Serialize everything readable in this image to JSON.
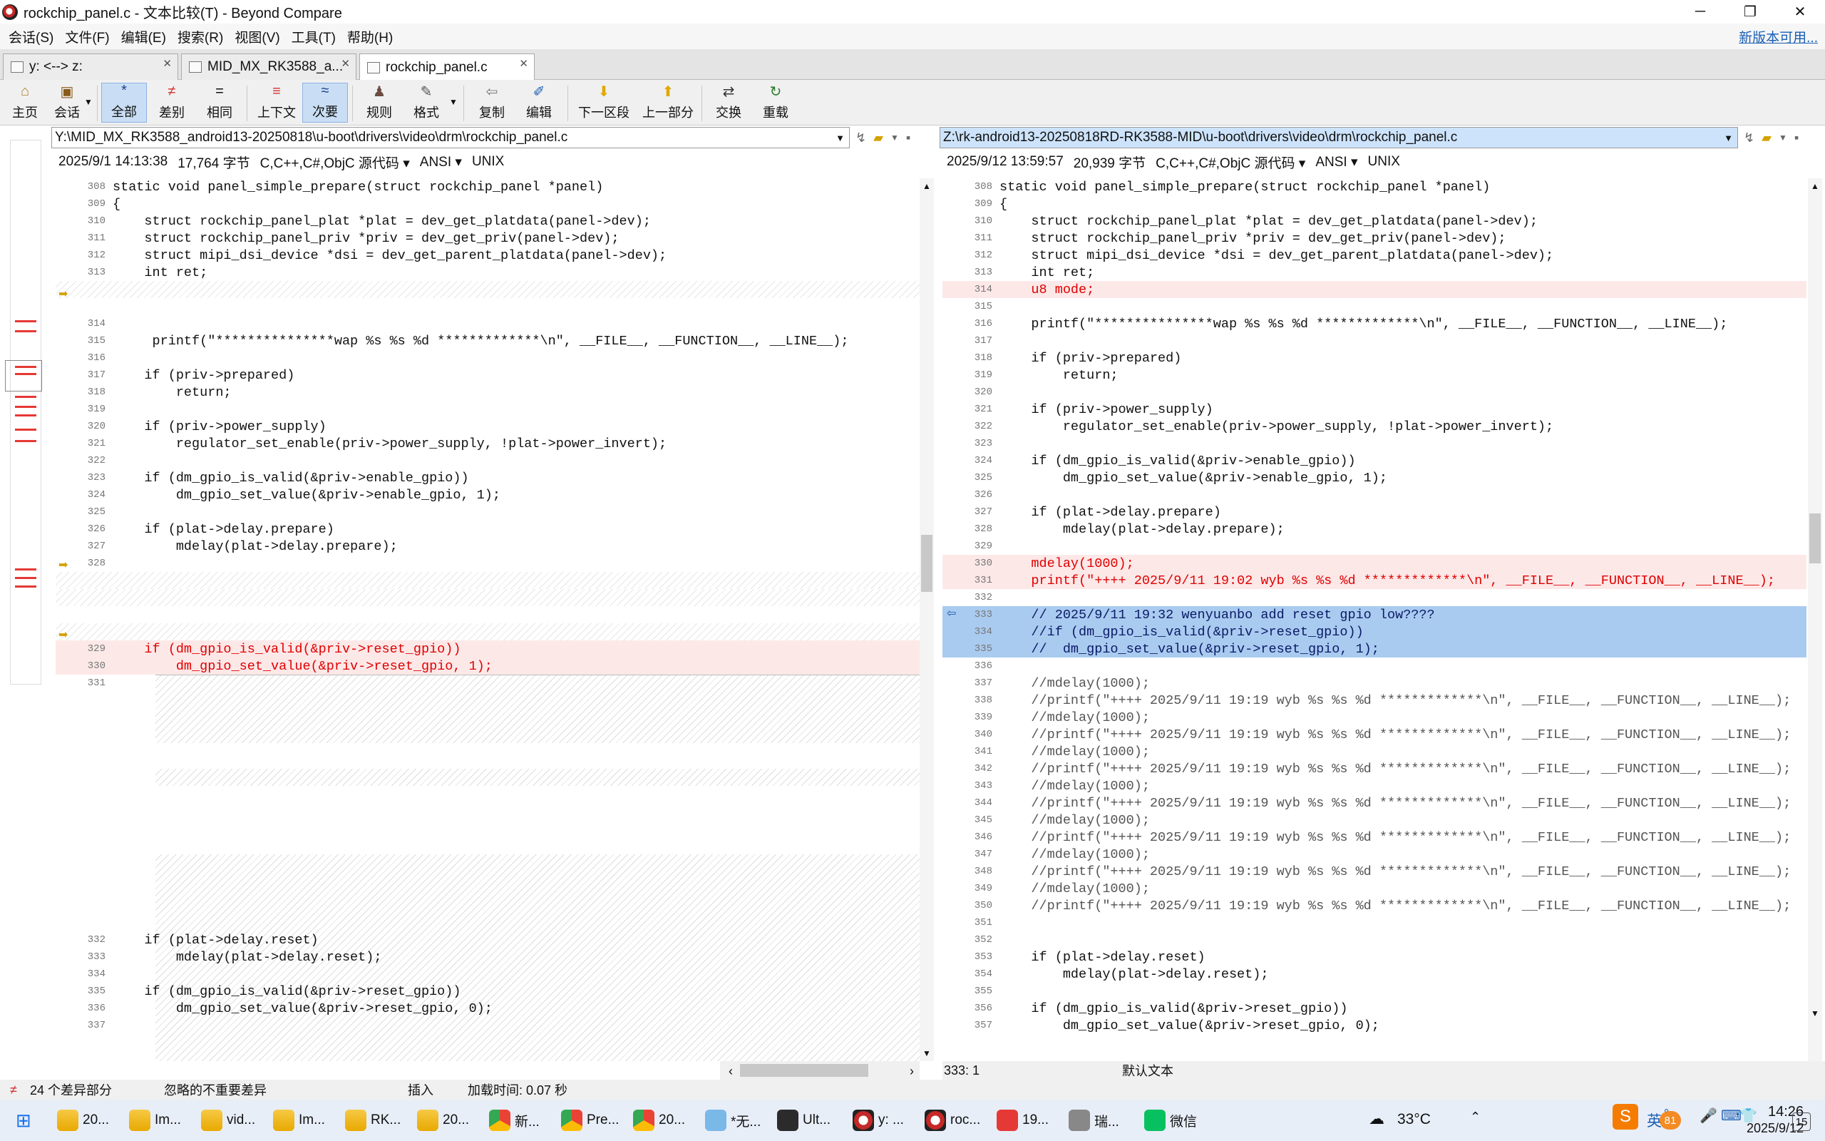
{
  "window": {
    "title": "rockchip_panel.c - 文本比较(T) - Beyond Compare",
    "min": "─",
    "max": "❐",
    "close": "✕"
  },
  "menu": {
    "items": [
      "会话(S)",
      "文件(F)",
      "编辑(E)",
      "搜索(R)",
      "视图(V)",
      "工具(T)",
      "帮助(H)"
    ],
    "update": "新版本可用..."
  },
  "tabs": [
    {
      "label": "y: <--> z:"
    },
    {
      "label": "MID_MX_RK3588_a..."
    },
    {
      "label": "rockchip_panel.c"
    }
  ],
  "toolbar": {
    "home": "主页",
    "session": "会话",
    "all": "全部",
    "diffs": "差别",
    "same": "相同",
    "context": "上下文",
    "minor": "次要",
    "rules": "规则",
    "format": "格式",
    "copy": "复制",
    "edit": "编辑",
    "next": "下一区段",
    "prev": "上一部分",
    "swap": "交换",
    "reload": "重载"
  },
  "left": {
    "path": "Y:\\MID_MX_RK3588_android13-20250818\\u-boot\\drivers\\video\\drm\\rockchip_panel.c",
    "date": "2025/9/1 14:13:38",
    "size": "17,764 字节",
    "lang": "C,C++,C#,ObjC 源代码",
    "enc": "ANSI",
    "eol": "UNIX"
  },
  "right": {
    "path": "Z:\\rk-android13-20250818RD-RK3588-MID\\u-boot\\drivers\\video\\drm\\rockchip_panel.c",
    "date": "2025/9/12 13:59:57",
    "size": "20,939 字节",
    "lang": "C,C++,C#,ObjC 源代码",
    "enc": "ANSI",
    "eol": "UNIX"
  },
  "left_lines": [
    {
      "n": "308",
      "t": "static void panel_simple_prepare(struct rockchip_panel *panel)"
    },
    {
      "n": "309",
      "t": "{"
    },
    {
      "n": "310",
      "t": "    struct rockchip_panel_plat *plat = dev_get_platdata(panel->dev);"
    },
    {
      "n": "311",
      "t": "    struct rockchip_panel_priv *priv = dev_get_priv(panel->dev);"
    },
    {
      "n": "312",
      "t": "    struct mipi_dsi_device *dsi = dev_get_parent_platdata(panel->dev);"
    },
    {
      "n": "313",
      "t": "    int ret;"
    },
    {
      "n": "",
      "t": "",
      "cls": "gap"
    },
    {
      "n": "",
      "t": ""
    },
    {
      "n": "314",
      "t": ""
    },
    {
      "n": "315",
      "t": "     printf(\"***************wap %s %s %d *************\\n\", __FILE__, __FUNCTION__, __LINE__);"
    },
    {
      "n": "316",
      "t": ""
    },
    {
      "n": "317",
      "t": "    if (priv->prepared)"
    },
    {
      "n": "318",
      "t": "        return;"
    },
    {
      "n": "319",
      "t": ""
    },
    {
      "n": "320",
      "t": "    if (priv->power_supply)"
    },
    {
      "n": "321",
      "t": "        regulator_set_enable(priv->power_supply, !plat->power_invert);"
    },
    {
      "n": "322",
      "t": ""
    },
    {
      "n": "323",
      "t": "    if (dm_gpio_is_valid(&priv->enable_gpio))"
    },
    {
      "n": "324",
      "t": "        dm_gpio_set_value(&priv->enable_gpio, 1);"
    },
    {
      "n": "325",
      "t": ""
    },
    {
      "n": "326",
      "t": "    if (plat->delay.prepare)"
    },
    {
      "n": "327",
      "t": "        mdelay(plat->delay.prepare);"
    },
    {
      "n": "328",
      "t": ""
    },
    {
      "n": "",
      "t": "",
      "cls": "gap"
    },
    {
      "n": "",
      "t": "",
      "cls": "gap"
    },
    {
      "n": "",
      "t": ""
    },
    {
      "n": "",
      "t": "",
      "cls": "gap"
    },
    {
      "n": "329",
      "t": "    if (dm_gpio_is_valid(&priv->reset_gpio))",
      "cls": "diff"
    },
    {
      "n": "330",
      "t": "        dm_gpio_set_value(&priv->reset_gpio, 1);",
      "cls": "diff"
    },
    {
      "n": "331",
      "t": ""
    }
  ],
  "left_tail": [
    {
      "n": "332",
      "t": "    if (plat->delay.reset)"
    },
    {
      "n": "333",
      "t": "        mdelay(plat->delay.reset);"
    },
    {
      "n": "334",
      "t": ""
    },
    {
      "n": "335",
      "t": "    if (dm_gpio_is_valid(&priv->reset_gpio))"
    },
    {
      "n": "336",
      "t": "        dm_gpio_set_value(&priv->reset_gpio, 0);"
    },
    {
      "n": "337",
      "t": ""
    }
  ],
  "right_lines": [
    {
      "n": "308",
      "t": "static void panel_simple_prepare(struct rockchip_panel *panel)"
    },
    {
      "n": "309",
      "t": "{"
    },
    {
      "n": "310",
      "t": "    struct rockchip_panel_plat *plat = dev_get_platdata(panel->dev);"
    },
    {
      "n": "311",
      "t": "    struct rockchip_panel_priv *priv = dev_get_priv(panel->dev);"
    },
    {
      "n": "312",
      "t": "    struct mipi_dsi_device *dsi = dev_get_parent_platdata(panel->dev);"
    },
    {
      "n": "313",
      "t": "    int ret;"
    },
    {
      "n": "314",
      "t": "    u8 mode;",
      "cls": "diff"
    },
    {
      "n": "315",
      "t": ""
    },
    {
      "n": "316",
      "t": "    printf(\"***************wap %s %s %d *************\\n\", __FILE__, __FUNCTION__, __LINE__);"
    },
    {
      "n": "317",
      "t": ""
    },
    {
      "n": "318",
      "t": "    if (priv->prepared)"
    },
    {
      "n": "319",
      "t": "        return;"
    },
    {
      "n": "320",
      "t": ""
    },
    {
      "n": "321",
      "t": "    if (priv->power_supply)"
    },
    {
      "n": "322",
      "t": "        regulator_set_enable(priv->power_supply, !plat->power_invert);"
    },
    {
      "n": "323",
      "t": ""
    },
    {
      "n": "324",
      "t": "    if (dm_gpio_is_valid(&priv->enable_gpio))"
    },
    {
      "n": "325",
      "t": "        dm_gpio_set_value(&priv->enable_gpio, 1);"
    },
    {
      "n": "326",
      "t": ""
    },
    {
      "n": "327",
      "t": "    if (plat->delay.prepare)"
    },
    {
      "n": "328",
      "t": "        mdelay(plat->delay.prepare);"
    },
    {
      "n": "329",
      "t": ""
    },
    {
      "n": "330",
      "t": "    mdelay(1000);",
      "cls": "diff"
    },
    {
      "n": "331",
      "t": "    printf(\"++++ 2025/9/11 19:02 wyb %s %s %d *************\\n\", __FILE__, __FUNCTION__, __LINE__);",
      "cls": "diff"
    },
    {
      "n": "332",
      "t": ""
    },
    {
      "n": "333",
      "t": "    // 2025/9/11 19:32 wenyuanbo add reset gpio low????",
      "cls": "blue"
    },
    {
      "n": "334",
      "t": "    //if (dm_gpio_is_valid(&priv->reset_gpio))",
      "cls": "blue"
    },
    {
      "n": "335",
      "t": "    //  dm_gpio_set_value(&priv->reset_gpio, 1);",
      "cls": "blue"
    },
    {
      "n": "336",
      "t": ""
    },
    {
      "n": "337",
      "t": "    //mdelay(1000);",
      "cls": "cmt"
    },
    {
      "n": "338",
      "t": "    //printf(\"++++ 2025/9/11 19:19 wyb %s %s %d *************\\n\", __FILE__, __FUNCTION__, __LINE__);",
      "cls": "cmt"
    },
    {
      "n": "339",
      "t": "    //mdelay(1000);",
      "cls": "cmt"
    },
    {
      "n": "340",
      "t": "    //printf(\"++++ 2025/9/11 19:19 wyb %s %s %d *************\\n\", __FILE__, __FUNCTION__, __LINE__);",
      "cls": "cmt"
    },
    {
      "n": "341",
      "t": "    //mdelay(1000);",
      "cls": "cmt"
    },
    {
      "n": "342",
      "t": "    //printf(\"++++ 2025/9/11 19:19 wyb %s %s %d *************\\n\", __FILE__, __FUNCTION__, __LINE__);",
      "cls": "cmt"
    },
    {
      "n": "343",
      "t": "    //mdelay(1000);",
      "cls": "cmt"
    },
    {
      "n": "344",
      "t": "    //printf(\"++++ 2025/9/11 19:19 wyb %s %s %d *************\\n\", __FILE__, __FUNCTION__, __LINE__);",
      "cls": "cmt"
    },
    {
      "n": "345",
      "t": "    //mdelay(1000);",
      "cls": "cmt"
    },
    {
      "n": "346",
      "t": "    //printf(\"++++ 2025/9/11 19:19 wyb %s %s %d *************\\n\", __FILE__, __FUNCTION__, __LINE__);",
      "cls": "cmt"
    },
    {
      "n": "347",
      "t": "    //mdelay(1000);",
      "cls": "cmt"
    },
    {
      "n": "348",
      "t": "    //printf(\"++++ 2025/9/11 19:19 wyb %s %s %d *************\\n\", __FILE__, __FUNCTION__, __LINE__);",
      "cls": "cmt"
    },
    {
      "n": "349",
      "t": "    //mdelay(1000);",
      "cls": "cmt"
    },
    {
      "n": "350",
      "t": "    //printf(\"++++ 2025/9/11 19:19 wyb %s %s %d *************\\n\", __FILE__, __FUNCTION__, __LINE__);",
      "cls": "cmt"
    },
    {
      "n": "351",
      "t": ""
    },
    {
      "n": "352",
      "t": ""
    },
    {
      "n": "353",
      "t": "    if (plat->delay.reset)"
    },
    {
      "n": "354",
      "t": "        mdelay(plat->delay.reset);"
    },
    {
      "n": "355",
      "t": ""
    },
    {
      "n": "356",
      "t": "    if (dm_gpio_is_valid(&priv->reset_gpio))"
    },
    {
      "n": "357",
      "t": "        dm_gpio_set_value(&priv->reset_gpio, 0);"
    }
  ],
  "status": {
    "diffs": "24 个差异部分",
    "ignored": "忽略的不重要差异",
    "mode": "插入",
    "load": "加载时间: 0.07 秒",
    "pos": "333: 1",
    "enc": "默认文本"
  },
  "taskbar": {
    "items": [
      "20...",
      "Im...",
      "vid...",
      "Im...",
      "RK...",
      "20...",
      "新...",
      "Pre...",
      "20...",
      "*无...",
      "Ult...",
      "y: ...",
      "roc...",
      "19...",
      "瑞...",
      "微信"
    ],
    "weather": "33°C",
    "ime": "英",
    "time": "14:26",
    "date": "2025/9/12",
    "badge": "15",
    "notif": "81"
  }
}
